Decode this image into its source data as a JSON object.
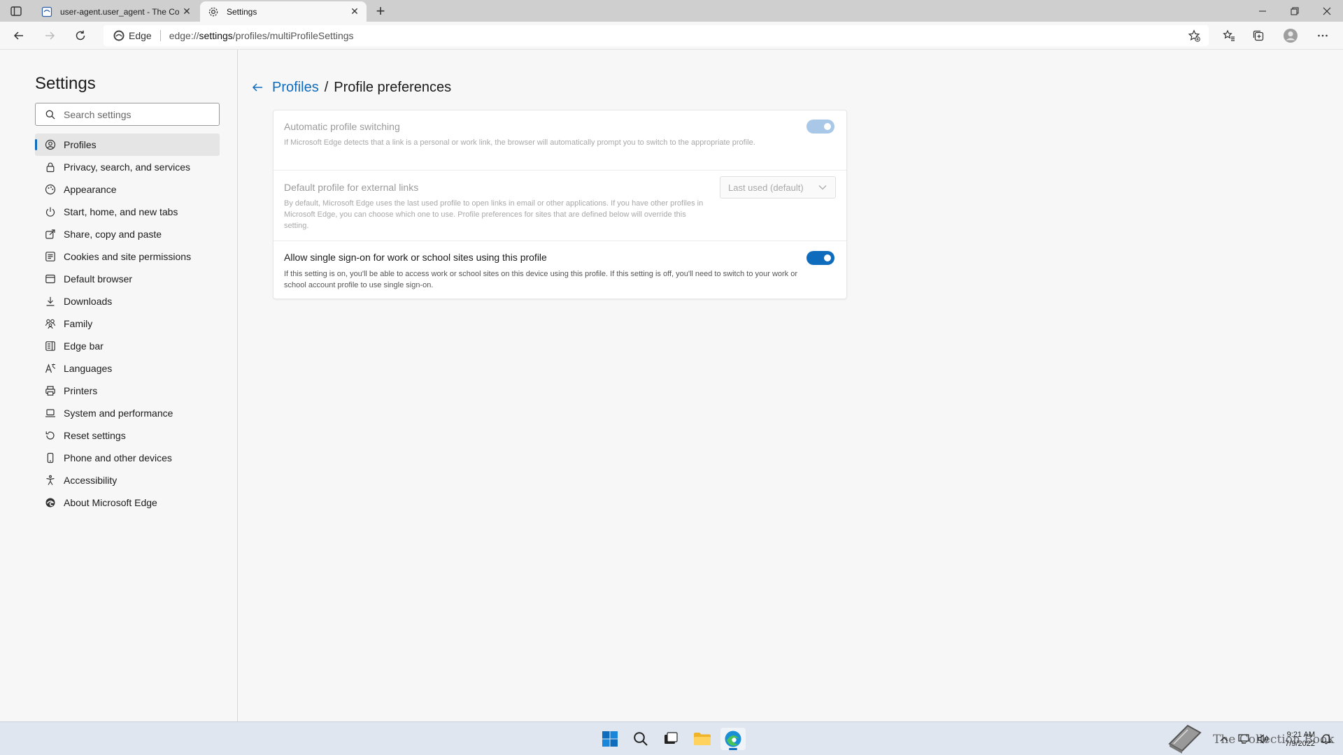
{
  "browser": {
    "tabs": [
      {
        "title": "user-agent.user_agent - The Coll",
        "icon": "document-icon"
      },
      {
        "title": "Settings",
        "icon": "gear-icon"
      }
    ],
    "address": {
      "site_label": "Edge",
      "url_prefix": "edge://",
      "url_host": "settings",
      "url_path": "/profiles/multiProfileSettings"
    }
  },
  "sidebar": {
    "title": "Settings",
    "search_placeholder": "Search settings",
    "items": [
      {
        "label": "Profiles",
        "icon": "profile-icon",
        "active": true
      },
      {
        "label": "Privacy, search, and services",
        "icon": "lock-icon"
      },
      {
        "label": "Appearance",
        "icon": "appearance-icon"
      },
      {
        "label": "Start, home, and new tabs",
        "icon": "power-icon"
      },
      {
        "label": "Share, copy and paste",
        "icon": "share-icon"
      },
      {
        "label": "Cookies and site permissions",
        "icon": "permissions-icon"
      },
      {
        "label": "Default browser",
        "icon": "browser-icon"
      },
      {
        "label": "Downloads",
        "icon": "download-icon"
      },
      {
        "label": "Family",
        "icon": "family-icon"
      },
      {
        "label": "Edge bar",
        "icon": "edge-bar-icon"
      },
      {
        "label": "Languages",
        "icon": "languages-icon"
      },
      {
        "label": "Printers",
        "icon": "printer-icon"
      },
      {
        "label": "System and performance",
        "icon": "laptop-icon"
      },
      {
        "label": "Reset settings",
        "icon": "reset-icon"
      },
      {
        "label": "Phone and other devices",
        "icon": "phone-icon"
      },
      {
        "label": "Accessibility",
        "icon": "accessibility-icon"
      },
      {
        "label": "About Microsoft Edge",
        "icon": "edge-logo-icon"
      }
    ]
  },
  "main": {
    "breadcrumb_link": "Profiles",
    "breadcrumb_separator": "/",
    "breadcrumb_current": "Profile preferences",
    "settings": [
      {
        "title": "Automatic profile switching",
        "description": "If Microsoft Edge detects that a link is a personal or work link, the browser will automatically prompt you to switch to the appropriate profile.",
        "toggle": "on",
        "disabled": true
      },
      {
        "title": "Default profile for external links",
        "description": "By default, Microsoft Edge uses the last used profile to open links in email or other applications. If you have other profiles in Microsoft Edge, you can choose which one to use. Profile preferences for sites that are defined below will override this setting.",
        "dropdown_value": "Last used (default)",
        "disabled": true
      },
      {
        "title": "Allow single sign-on for work or school sites using this profile",
        "description": "If this setting is on, you'll be able to access work or school sites on this device using this profile. If this setting is off, you'll need to switch to your work or school account profile to use single sign-on.",
        "toggle": "on",
        "disabled": false
      }
    ]
  },
  "taskbar": {
    "watermark": "The Collection Book",
    "time": "9:21 AM",
    "date": "7/9/2022"
  },
  "colors": {
    "accent": "#0f6cbd",
    "disabled_toggle": "#a9c8e8"
  }
}
